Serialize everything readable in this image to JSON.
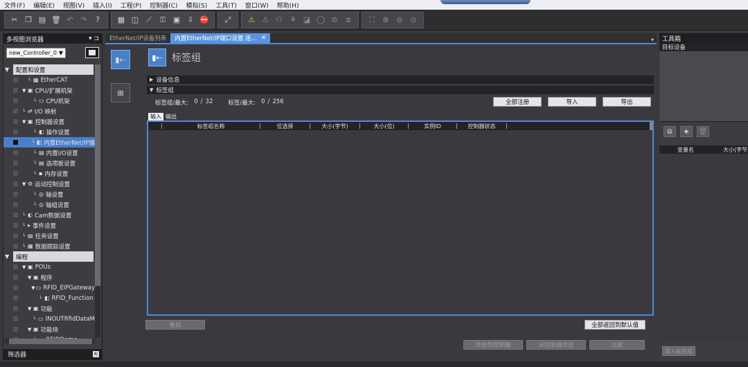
{
  "menu": [
    "文件(F)",
    "编辑(E)",
    "视图(V)",
    "插入(I)",
    "工程(P)",
    "控制器(C)",
    "模拟(S)",
    "工具(T)",
    "窗口(W)",
    "帮助(H)"
  ],
  "toolbar": {
    "group1": [
      "cut-icon",
      "copy-icon",
      "paste-icon",
      "delete-icon",
      "undo-icon",
      "redo-icon",
      "help-icon"
    ],
    "group2": [
      "build-icon",
      "monitor-icon",
      "transfer-icon",
      "online-icon",
      "sync-icon",
      "download-icon",
      "stop-icon"
    ],
    "group3": [
      "cross-ref-icon"
    ],
    "group4": [
      "warning-icon",
      "sim-run-icon",
      "sim-step-icon",
      "sim-pause-icon",
      "sim-stop-icon",
      "sim-reset-icon",
      "sim-break-icon",
      "sim-watch-icon"
    ],
    "group5": [
      "fit-icon",
      "zoom-in-icon",
      "zoom-out-icon",
      "zoom-reset-icon"
    ]
  },
  "left_panel": {
    "title": "多视图浏览器",
    "controller": "new_Controller_0",
    "tree": [
      {
        "type": "section",
        "label": "配置和设置"
      },
      {
        "indent": 2,
        "label": "EtherCAT",
        "icon": "▦"
      },
      {
        "indent": 1,
        "label": "CPU/扩展机架",
        "toggle": "▼",
        "icon": "▣"
      },
      {
        "indent": 3,
        "label": "CPU机架",
        "icon": "▭"
      },
      {
        "indent": 1,
        "label": "I/O 映射",
        "icon": "⇄"
      },
      {
        "indent": 1,
        "label": "控制器设置",
        "toggle": "▼",
        "icon": "▣"
      },
      {
        "indent": 3,
        "label": "操作设置",
        "icon": "◧"
      },
      {
        "indent": 3,
        "label": "内置EtherNet/IP端",
        "icon": "◧",
        "selected": true
      },
      {
        "indent": 3,
        "label": "内置I/O设置",
        "icon": "▤"
      },
      {
        "indent": 3,
        "label": "选项板设置",
        "icon": "▤"
      },
      {
        "indent": 3,
        "label": "内存设置",
        "icon": "▪"
      },
      {
        "indent": 1,
        "label": "运动控制设置",
        "toggle": "▼",
        "icon": "⚙"
      },
      {
        "indent": 3,
        "label": "轴设置",
        "icon": "◎"
      },
      {
        "indent": 3,
        "label": "轴组设置",
        "icon": "◎"
      },
      {
        "indent": 1,
        "label": "Cam数据设置",
        "icon": "◐"
      },
      {
        "indent": 1,
        "label": "事件设置",
        "icon": "▸"
      },
      {
        "indent": 1,
        "label": "任务设置",
        "icon": "▤"
      },
      {
        "indent": 1,
        "label": "数据跟踪设置",
        "icon": "▦"
      },
      {
        "type": "section",
        "label": "编程"
      },
      {
        "indent": 1,
        "label": "POUs",
        "toggle": "▼",
        "icon": "▣"
      },
      {
        "indent": 2,
        "label": "程序",
        "toggle": "▼",
        "icon": "▣"
      },
      {
        "indent": 3,
        "label": "RFID_EIPGateway",
        "toggle": "▼",
        "icon": "▭"
      },
      {
        "indent": 4,
        "label": "RFID_Function",
        "icon": "◧"
      },
      {
        "indent": 2,
        "label": "功能",
        "toggle": "▼",
        "icon": "▣"
      },
      {
        "indent": 3,
        "label": "INOUTRfidDataM",
        "icon": "▭"
      },
      {
        "indent": 2,
        "label": "功能块",
        "toggle": "▼",
        "icon": "▣"
      },
      {
        "indent": 3,
        "label": "RFIDDemo",
        "icon": "▭"
      }
    ],
    "filter": "筛选器"
  },
  "center": {
    "tabs": [
      {
        "label": "EtherNet/IP设备列表",
        "active": false
      },
      {
        "label": "内置EtherNet/IP端口设置 连...",
        "active": true
      }
    ],
    "page_title": "标签组",
    "section_device": "设备信息",
    "section_tags": "标签组",
    "stats": {
      "tag_group_label": "标签组/最大:",
      "tag_group_value": "0",
      "tag_group_sep": "/",
      "tag_group_max": "32",
      "tag_label": "标签/最大:",
      "tag_value": "0",
      "tag_sep": "/",
      "tag_max": "256"
    },
    "buttons": {
      "register_all": "全部注册",
      "import": "导入",
      "export": "导出"
    },
    "subtabs": [
      {
        "label": "输入",
        "active": true
      },
      {
        "label": "输出",
        "active": false
      }
    ],
    "columns": [
      "标签组名称",
      "位选择",
      "大小(字节)",
      "大小(位)",
      "实例ID",
      "控制器状态"
    ],
    "bottom": {
      "restart": "重启",
      "reset_defaults": "全部返回到默认值",
      "transfer_to": "传送到控制器",
      "transfer_from": "从控制器传送",
      "compare": "比较"
    }
  },
  "right_panel": {
    "title": "工具箱",
    "target": "目标设备",
    "columns": [
      "变量名",
      "大小(字节)"
    ],
    "import_button": "导入标签组"
  },
  "colors": {
    "accent": "#4f8ad6",
    "selected": "#4a7fcb",
    "bg": "#3a3a3e"
  }
}
